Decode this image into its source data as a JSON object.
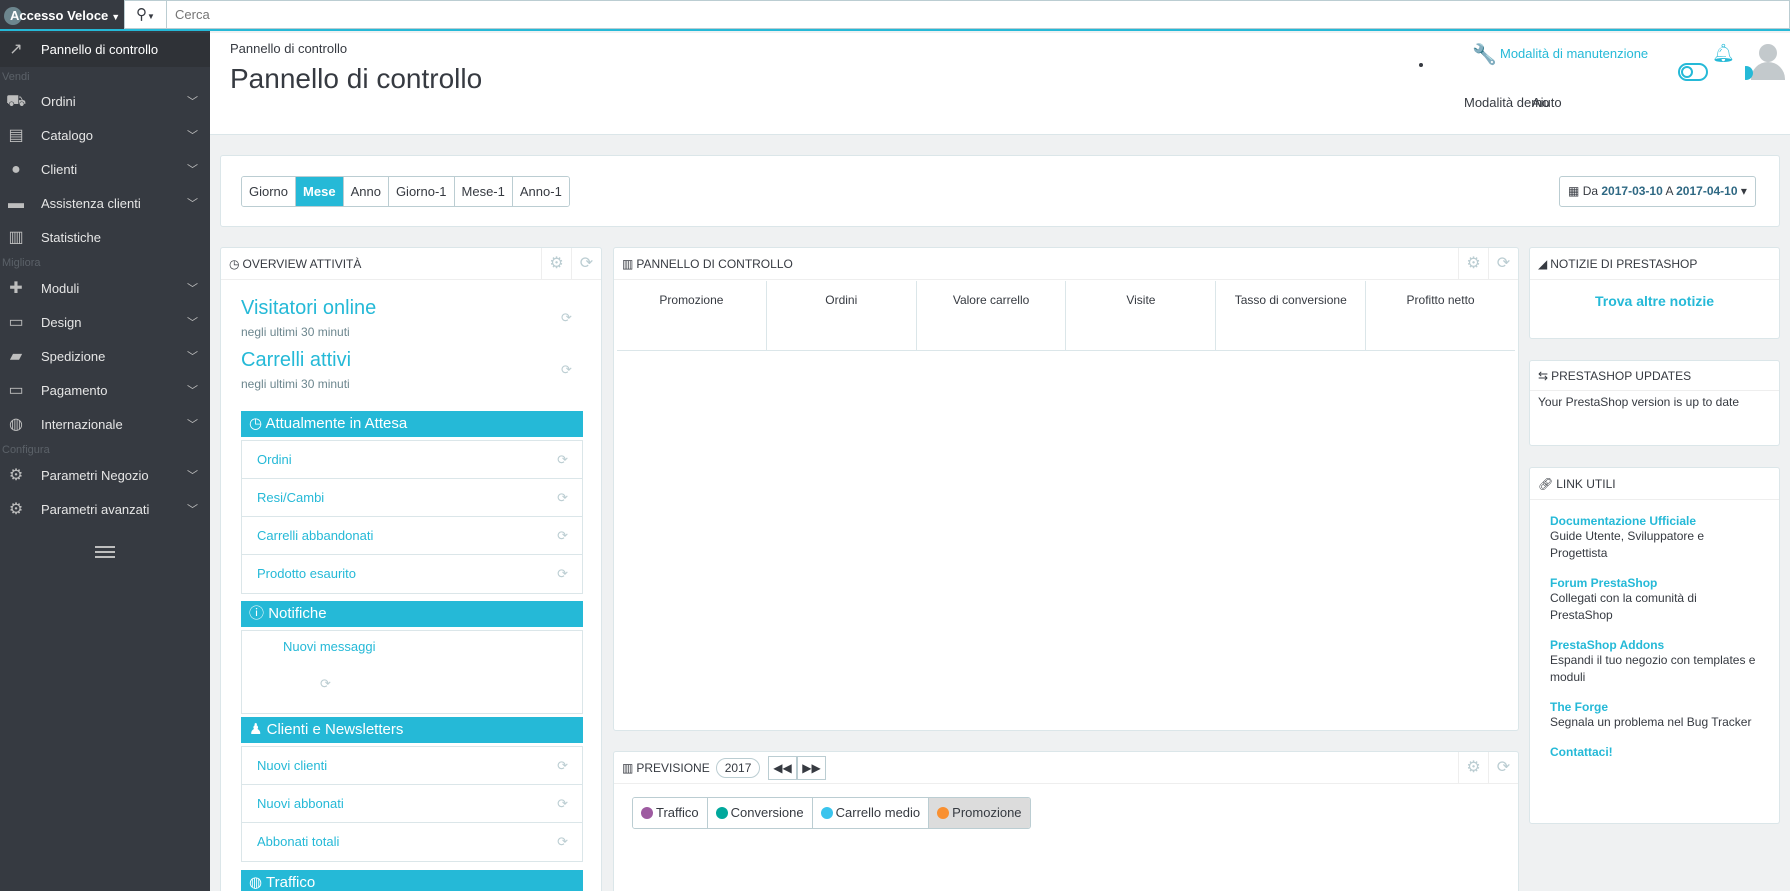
{
  "topbar": {
    "quick_access": "Accesso Veloce",
    "search_placeholder": "Cerca"
  },
  "sidebar": {
    "dashboard": "Pannello di controllo",
    "sections": [
      "Vendi",
      "Migliora",
      "Configura"
    ],
    "items": [
      {
        "label": "Ordini",
        "icon": "basket-icon"
      },
      {
        "label": "Catalogo",
        "icon": "store-icon"
      },
      {
        "label": "Clienti",
        "icon": "user-icon"
      },
      {
        "label": "Assistenza clienti",
        "icon": "chat-icon"
      },
      {
        "label": "Statistiche",
        "icon": "chart-icon"
      },
      {
        "label": "Moduli",
        "icon": "puzzle-icon"
      },
      {
        "label": "Design",
        "icon": "monitor-icon"
      },
      {
        "label": "Spedizione",
        "icon": "truck-icon"
      },
      {
        "label": "Pagamento",
        "icon": "card-icon"
      },
      {
        "label": "Internazionale",
        "icon": "globe-icon"
      },
      {
        "label": "Parametri Negozio",
        "icon": "gear-icon"
      },
      {
        "label": "Parametri avanzati",
        "icon": "cog-box-icon"
      }
    ]
  },
  "header": {
    "breadcrumb": "Pannello di controllo",
    "title": "Pannello di controllo",
    "maintenance": "Modalità di manutenzione",
    "demo_mode": "Modalità demo",
    "help": "Aiuto"
  },
  "period": {
    "tabs": [
      "Giorno",
      "Mese",
      "Anno",
      "Giorno-1",
      "Mese-1",
      "Anno-1"
    ],
    "active": "Mese",
    "from_label": "Da",
    "from": "2017-03-10",
    "to_label": "A",
    "to": "2017-04-10"
  },
  "activity": {
    "title": "Overview attività",
    "visitors_title": "Visitatori online",
    "visitors_sub": "negli ultimi 30 minuti",
    "carts_title": "Carrelli attivi",
    "carts_sub": "negli ultimi 30 minuti",
    "pending_title": "Attualmente in Attesa",
    "pending_items": [
      "Ordini",
      "Resi/Cambi",
      "Carrelli abbandonati",
      "Prodotto esaurito"
    ],
    "notifications_title": "Notifiche",
    "notifications_item": "Nuovi messaggi",
    "customers_title": "Clienti e Newsletters",
    "customers_items": [
      "Nuovi clienti",
      "Nuovi abbonati",
      "Abbonati totali"
    ],
    "traffic_title": "Traffico"
  },
  "dashboard": {
    "title": "Pannello di controllo",
    "columns": [
      "Promozione",
      "Ordini",
      "Valore carrello",
      "Visite",
      "Tasso di conversione",
      "Profitto netto"
    ]
  },
  "forecast": {
    "title": "Previsione",
    "year": "2017",
    "legend": [
      {
        "label": "Traffico",
        "color": "#9e5ba1"
      },
      {
        "label": "Conversione",
        "color": "#00a89c"
      },
      {
        "label": "Carrello medio",
        "color": "#3ac4ed"
      },
      {
        "label": "Promozione",
        "color": "#f99031"
      }
    ]
  },
  "news": {
    "title": "Notizie di PrestaShop",
    "link": "Trova altre notizie"
  },
  "updates": {
    "title": "PrestaShop Updates",
    "text": "Your PrestaShop version is up to date"
  },
  "links": {
    "title": "Link utili",
    "items": [
      {
        "title": "Documentazione Ufficiale",
        "desc": "Guide Utente, Sviluppatore e Progettista"
      },
      {
        "title": "Forum PrestaShop",
        "desc": "Collegati con la comunità di PrestaShop"
      },
      {
        "title": "PrestaShop Addons",
        "desc": "Espandi il tuo negozio con templates e moduli"
      },
      {
        "title": "The Forge",
        "desc": "Segnala un problema nel Bug Tracker"
      },
      {
        "title": "Contattaci!",
        "desc": ""
      }
    ]
  },
  "colors": {
    "accent": "#25b9d7",
    "sidebar": "#363a41",
    "bg": "#eff1f2"
  }
}
